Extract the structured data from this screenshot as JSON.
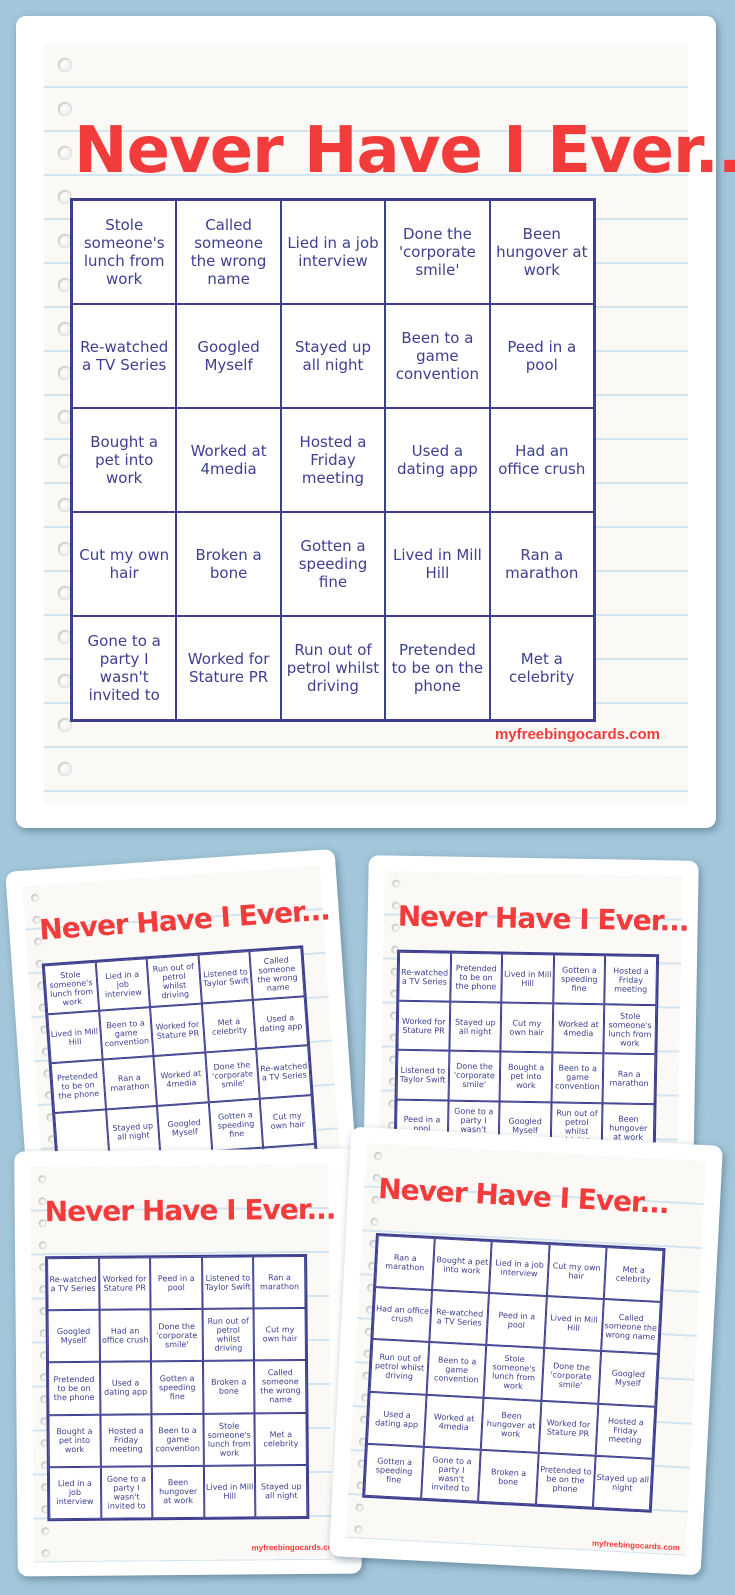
{
  "title": "Never Have I Ever...",
  "site": "myfreebingocards.com",
  "colors": {
    "background": "#a3c6da",
    "title": "#f23c3c",
    "grid": "#3d3f8f"
  },
  "main_card": {
    "cells": [
      "Stole someone's lunch from work",
      "Called someone the wrong name",
      "Lied in a job interview",
      "Done the 'corporate smile'",
      "Been hungover at work",
      "Re-watched a TV Series",
      "Googled Myself",
      "Stayed up all night",
      "Been to a game convention",
      "Peed in a pool",
      "Bought a pet into work",
      "Worked at 4media",
      "Hosted a Friday meeting",
      "Used a dating app",
      "Had an office crush",
      "Cut my own hair",
      "Broken a bone",
      "Gotten a speeding fine",
      "Lived in Mill Hill",
      "Ran a marathon",
      "Gone to a party I wasn't invited to",
      "Worked for Stature PR",
      "Run out of petrol whilst driving",
      "Pretended to be on the phone",
      "Met a celebrity"
    ]
  },
  "preview_cards": [
    {
      "cells": [
        "Stole someone's lunch from work",
        "Lied in a job interview",
        "Run out of petrol whilst driving",
        "Listened to Taylor Swift",
        "Called someone the wrong name",
        "Lived in Mill Hill",
        "Been to a game convention",
        "Worked for Stature PR",
        "Met a celebrity",
        "Used a dating app",
        "Pretended to be on the phone",
        "Ran a marathon",
        "Worked at 4media",
        "Done the 'corporate smile'",
        "Re-watched a TV Series",
        "",
        "Stayed up all night",
        "Googled Myself",
        "Gotten a speeding fine",
        "Cut my own hair",
        "",
        "",
        "",
        "",
        ""
      ]
    },
    {
      "cells": [
        "Re-watched a TV Series",
        "Pretended to be on the phone",
        "Lived in Mill Hill",
        "Gotten a speeding fine",
        "Hosted a Friday meeting",
        "Worked for Stature PR",
        "Stayed up all night",
        "Cut my own hair",
        "Worked at 4media",
        "Stole someone's lunch from work",
        "Listened to Taylor Swift",
        "Done the 'corporate smile'",
        "Bought a pet into work",
        "Been to a game convention",
        "Ran a marathon",
        "Peed in a pool",
        "Gone to a party I wasn't invited to",
        "Googled Myself",
        "Run out of petrol whilst driving",
        "Been hungover at work",
        "",
        "",
        "",
        "",
        ""
      ]
    },
    {
      "cells": [
        "Re-watched a TV Series",
        "Worked for Stature PR",
        "Peed in a pool",
        "Listened to Taylor Swift",
        "Ran a marathon",
        "Googled Myself",
        "Had an office crush",
        "Done the 'corporate smile'",
        "Run out of petrol whilst driving",
        "Cut my own hair",
        "Pretended to be on the phone",
        "Used a dating app",
        "Gotten a speeding fine",
        "Broken a bone",
        "Called someone the wrong name",
        "Bought a pet into work",
        "Hosted a Friday meeting",
        "Been to a game convention",
        "Stole someone's lunch from work",
        "Met a celebrity",
        "Lied in a job interview",
        "Gone to a party I wasn't invited to",
        "Been hungover at work",
        "Lived in Mill Hill",
        "Stayed up all night"
      ]
    },
    {
      "cells": [
        "Ran a marathon",
        "Bought a pet into work",
        "Lied in a job interview",
        "Cut my own hair",
        "Met a celebrity",
        "Had an office crush",
        "Re-watched a TV Series",
        "Peed in a pool",
        "Lived in Mill Hill",
        "Called someone the wrong name",
        "Run out of petrol whilst driving",
        "Been to a game convention",
        "Stole someone's lunch from work",
        "Done the 'corporate smile'",
        "Googled Myself",
        "Used a dating app",
        "Worked at 4media",
        "Been hungover at work",
        "Worked for Stature PR",
        "Hosted a Friday meeting",
        "Gotten a speeding fine",
        "Gone to a party I wasn't invited to",
        "Broken a bone",
        "Pretended to be on the phone",
        "Stayed up all night"
      ]
    }
  ]
}
